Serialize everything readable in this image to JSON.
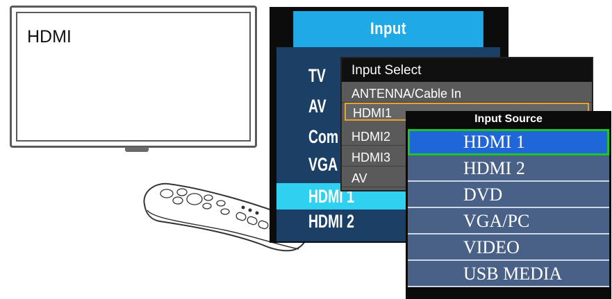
{
  "tv": {
    "label": "HDMI"
  },
  "input_menu": {
    "title": "Input",
    "items": [
      "TV",
      "AV",
      "Com",
      "VGA",
      "HDMI 1",
      "HDMI 2"
    ],
    "selected_index": 4
  },
  "input_select": {
    "title": "Input Select",
    "items": [
      "ANTENNA/Cable In",
      "HDMI1",
      "HDMI2",
      "HDMI3",
      "AV"
    ],
    "selected_index": 1
  },
  "input_source": {
    "title": "Input Source",
    "items": [
      "HDMI 1",
      "HDMI 2",
      "DVD",
      "VGA/PC",
      "VIDEO",
      "USB MEDIA"
    ],
    "selected_index": 0
  },
  "colors": {
    "input_header": "#1fa9e6",
    "input_body": "#1c3f66",
    "input_selected": "#2fd0f0",
    "select_highlight_border": "#e8a432",
    "source_item": "#4a6187",
    "source_active": "#1f66d8",
    "source_active_border": "#22c425"
  }
}
